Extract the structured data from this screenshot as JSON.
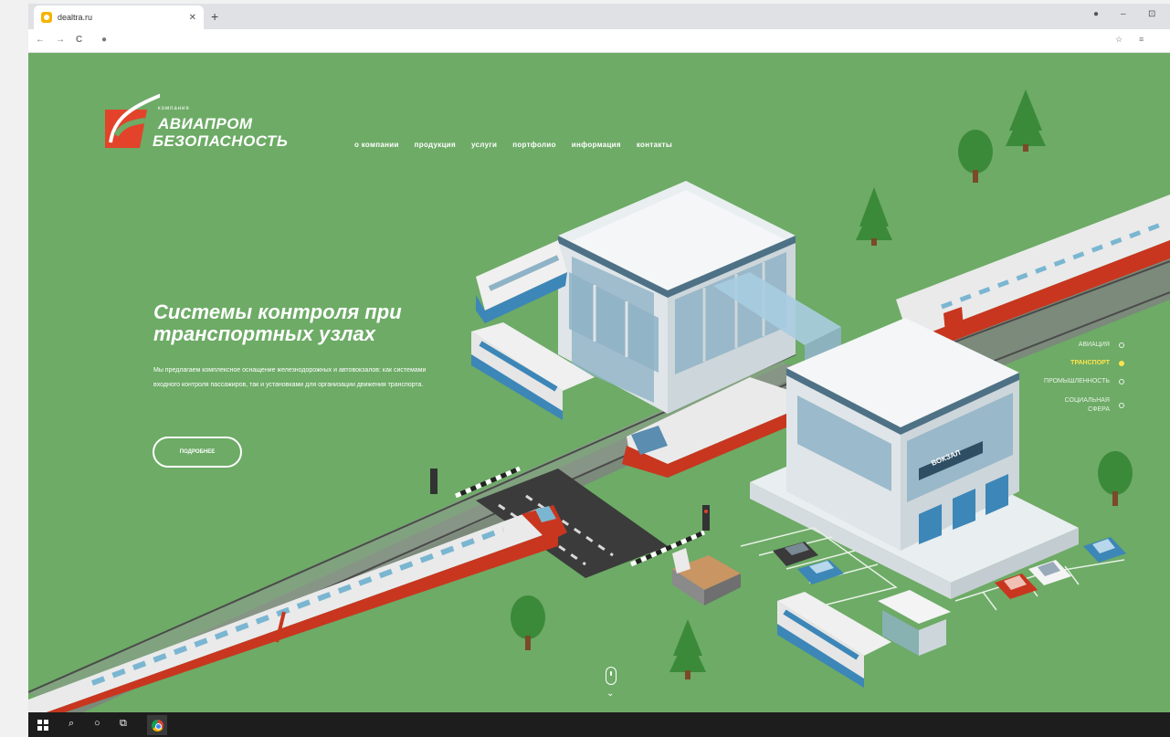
{
  "browser": {
    "tab_title": "dealtra.ru",
    "tab_close": "✕",
    "new_tab": "+",
    "win_controls": [
      "●",
      "–",
      "⊡"
    ],
    "nav_back": "←",
    "nav_forward": "→",
    "nav_reload": "C",
    "nav_home": "●",
    "ext_icons": [
      "☆",
      "≡"
    ]
  },
  "logo": {
    "small": "компания",
    "line1": "АВИАПРОМ",
    "line2": "БЕЗОПАСНОСТЬ"
  },
  "nav": {
    "items": [
      "о компании",
      "продукция",
      "услуги",
      "портфолио",
      "информация",
      "контакты"
    ]
  },
  "hero": {
    "title": "Системы контроля при транспортных узлах",
    "text": "Мы предлагаем комплексное оснащение железнодорожных и автовокзалов: как системами входного контроля пассажиров, так и установками для организации движения транспорта.",
    "button": "подробнее"
  },
  "sidenav": {
    "items": [
      {
        "label": "АВИАЦИЯ",
        "active": false
      },
      {
        "label": "ТРАНСПОРТ",
        "active": true
      },
      {
        "label": "ПРОМЫШЛЕННОСТЬ",
        "active": false
      },
      {
        "label": "СОЦИАЛЬНАЯ СФЕРА",
        "active": false
      }
    ]
  },
  "scene": {
    "station_sign": "ВОКЗАЛ"
  },
  "scroll": {
    "arrow": "⌄"
  },
  "colors": {
    "page_bg": "#6dab66",
    "logo_red": "#e2432a",
    "accent_yellow": "#ffe44d",
    "train_red": "#c8361f"
  },
  "icons": {
    "search": "⌕",
    "cortana": "○",
    "taskview": "⧉"
  }
}
